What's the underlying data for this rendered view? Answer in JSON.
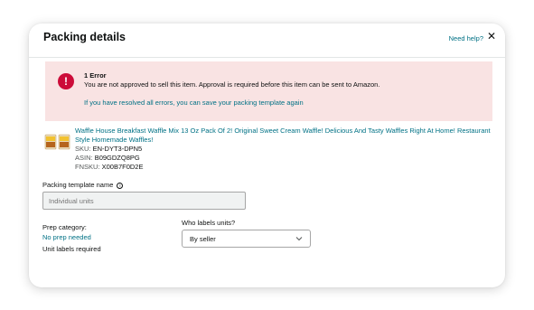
{
  "modal": {
    "title": "Packing details",
    "help_link": "Need help?",
    "close_glyph": "✕"
  },
  "error": {
    "icon": "exclamation-icon",
    "icon_glyph": "!",
    "title": "1 Error",
    "message": "You are not approved to sell this item. Approval is required before this item can be sent to Amazon.",
    "resolved_text": "If you have resolved all errors, you can save your packing template again"
  },
  "product": {
    "title": "Waffle House Breakfast Waffle Mix 13 Oz Pack Of 2! Original Sweet Cream Waffle! Delicious And Tasty Waffles Right At Home! Restaurant Style Homemade Waffles!",
    "sku_label": "SKU:",
    "sku": "EN-DYT3-DPN5",
    "asin_label": "ASIN:",
    "asin": "B09GDZQ8PG",
    "fnsku_label": "FNSKU:",
    "fnsku": "X00B7F0D2E"
  },
  "packing_template": {
    "label": "Packing template name",
    "info_glyph": "i",
    "placeholder": "Individual units"
  },
  "prep": {
    "label": "Prep category:",
    "value": "No prep needed",
    "unit_labels": "Unit labels required"
  },
  "who_labels": {
    "label": "Who labels units?",
    "selected": "By seller"
  },
  "colors": {
    "link": "#007185",
    "error_bg": "#f9e3e3",
    "error_icon": "#cc0c39"
  }
}
